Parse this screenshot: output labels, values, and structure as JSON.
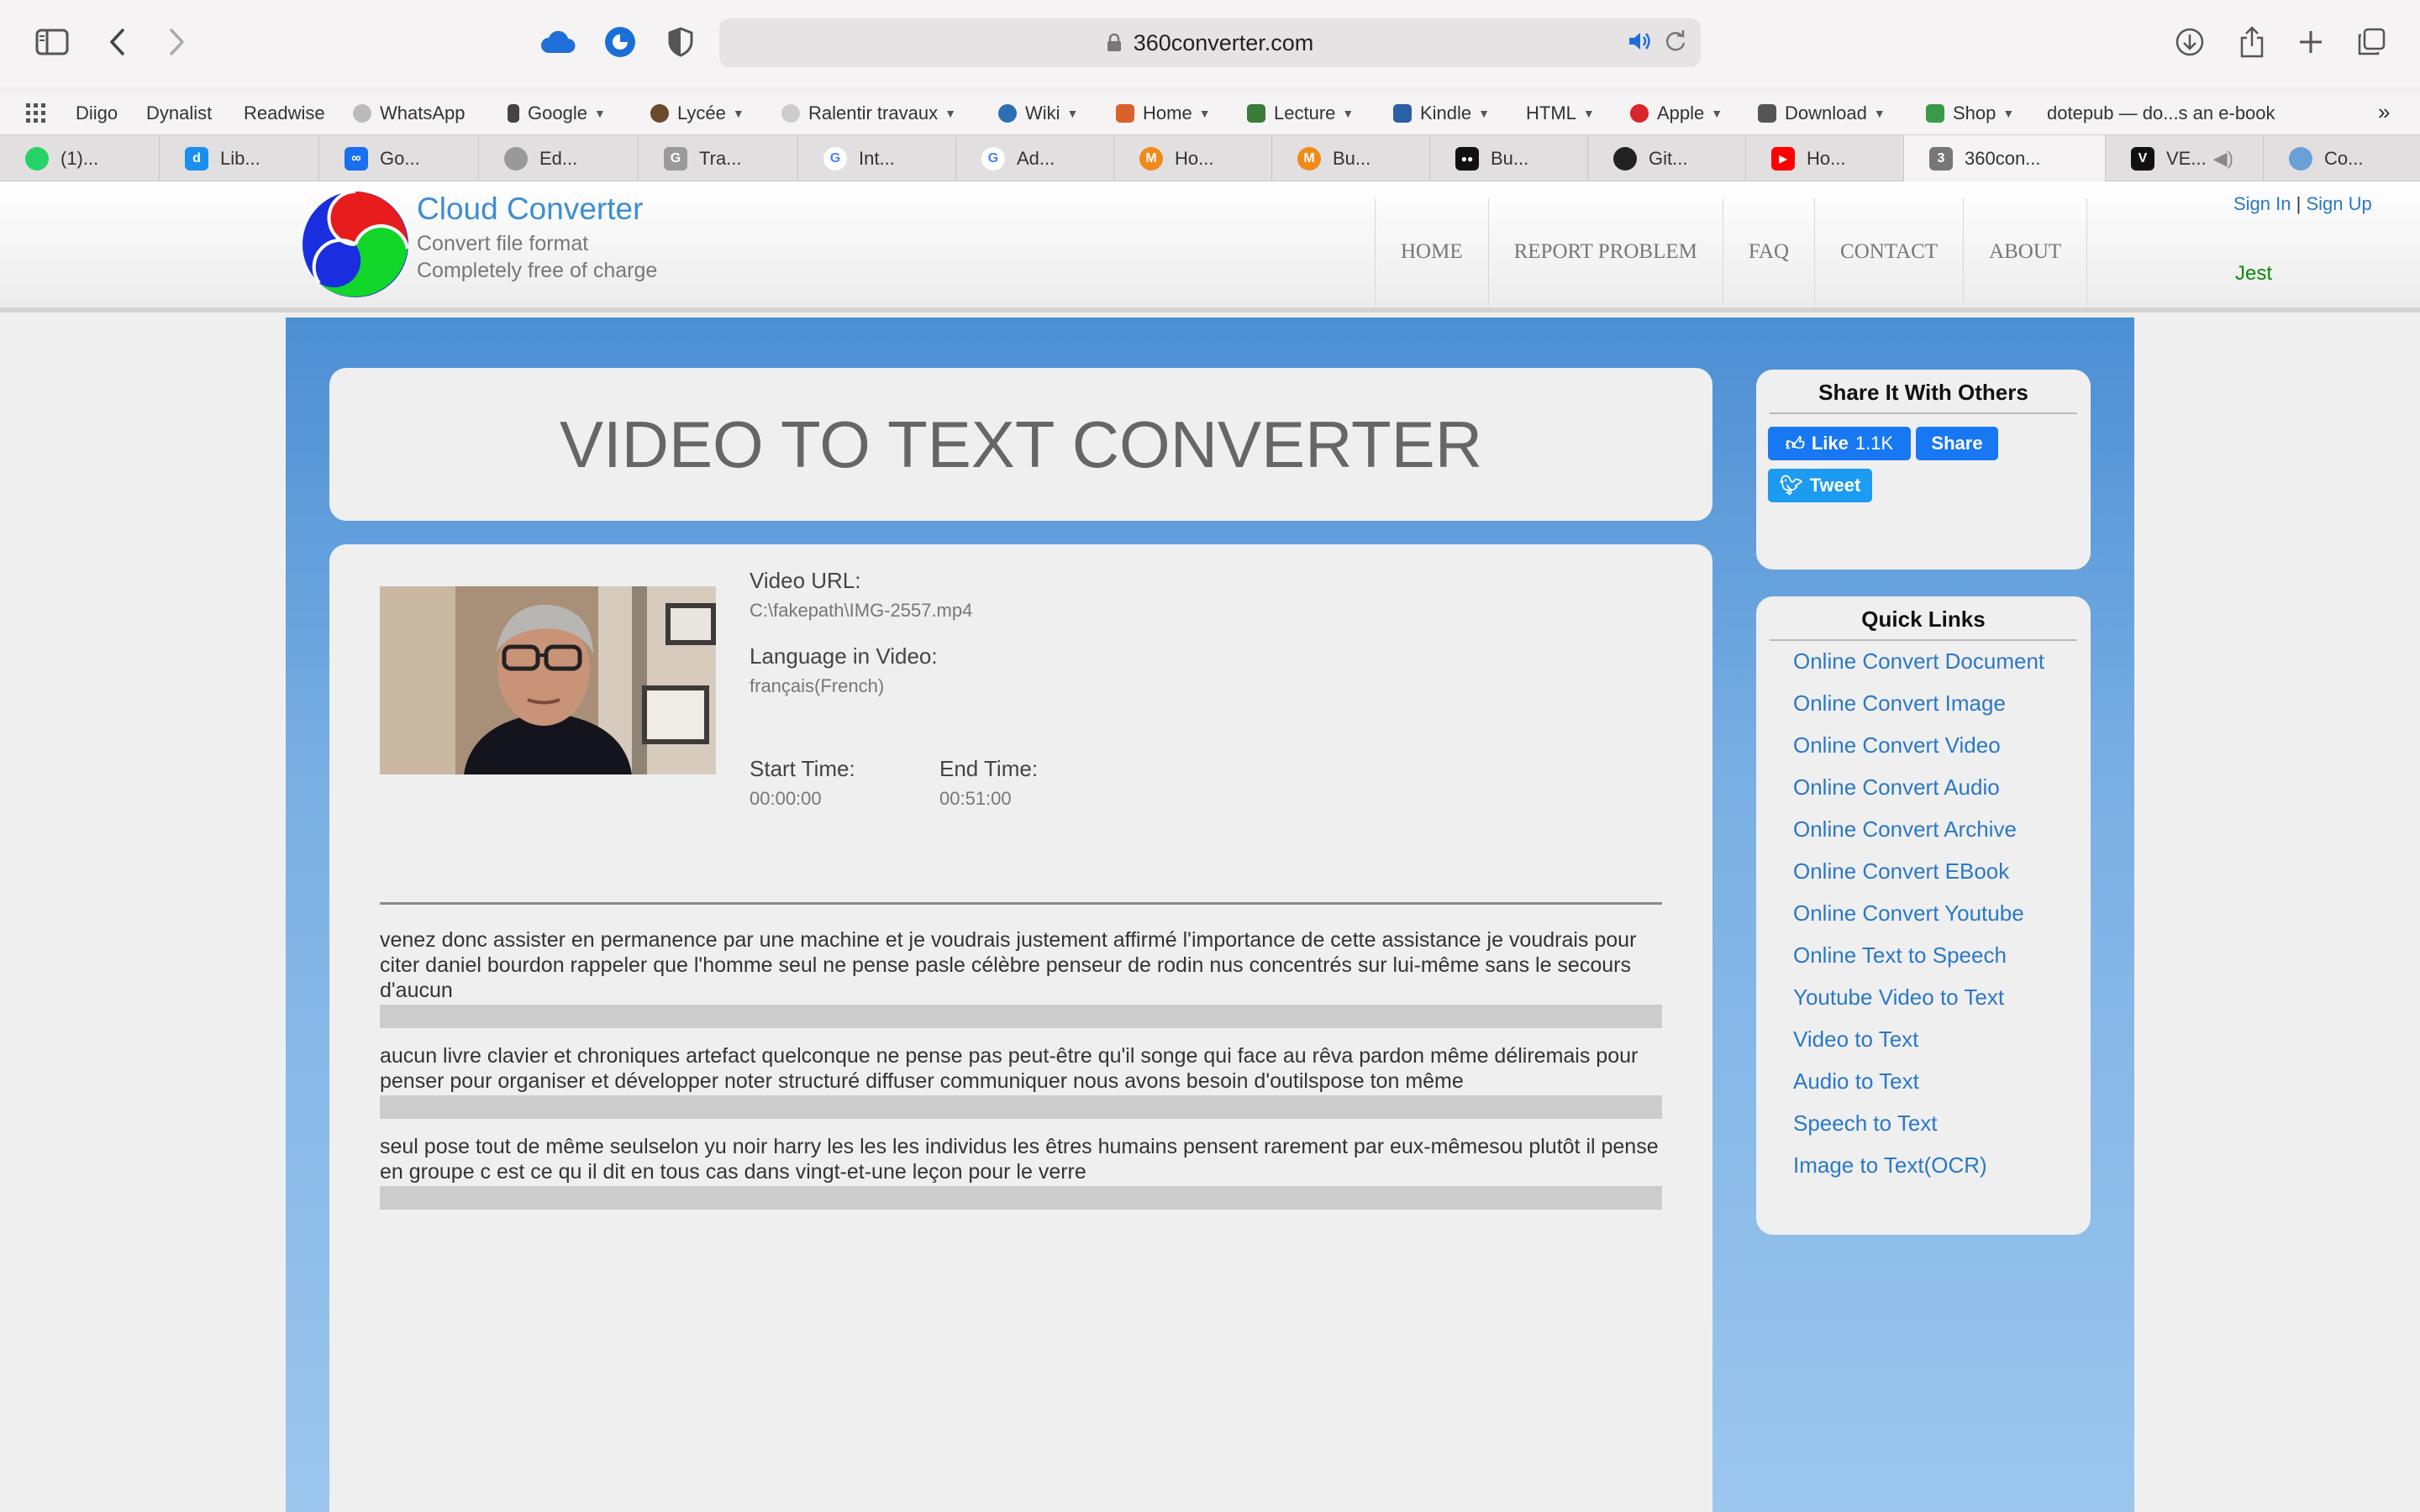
{
  "browser": {
    "url": "360converter.com"
  },
  "bookmarks": [
    {
      "label": "Diigo",
      "color": "",
      "menu": false
    },
    {
      "label": "Dynalist",
      "color": "",
      "menu": false
    },
    {
      "label": "Readwise",
      "color": "",
      "menu": false
    },
    {
      "label": "WhatsApp",
      "color": "#999999",
      "menu": false
    },
    {
      "label": "Google",
      "color": "#444444",
      "menu": true
    },
    {
      "label": "Lycée",
      "color": "#6b4a2e",
      "menu": true
    },
    {
      "label": "Ralentir travaux",
      "color": "#bbbbbb",
      "menu": true
    },
    {
      "label": "Wiki",
      "color": "#2d6fb3",
      "menu": true
    },
    {
      "label": "Home",
      "color": "#d9622b",
      "menu": true
    },
    {
      "label": "Lecture",
      "color": "#3a7d3a",
      "menu": true
    },
    {
      "label": "Kindle",
      "color": "#2b5fa6",
      "menu": true
    },
    {
      "label": "HTML",
      "color": "",
      "menu": true
    },
    {
      "label": "Apple",
      "color": "#d8262b",
      "menu": true
    },
    {
      "label": "Download",
      "color": "#555555",
      "menu": true
    },
    {
      "label": "Shop",
      "color": "#3a9a4a",
      "menu": true
    },
    {
      "label": "dotepub — do...s an e-book",
      "color": "",
      "menu": false
    }
  ],
  "tabs": [
    {
      "label": "(1)...",
      "color": "#25d366",
      "glyph": ""
    },
    {
      "label": "Lib...",
      "color": "#1a8ff0",
      "glyph": "d"
    },
    {
      "label": "Go...",
      "color": "#1a6ef0",
      "glyph": "∞"
    },
    {
      "label": "Ed...",
      "color": "#888888",
      "glyph": ""
    },
    {
      "label": "Tra...",
      "color": "#9a9a9a",
      "glyph": "G"
    },
    {
      "label": "Int...",
      "color": "#4285f4",
      "glyph": "G"
    },
    {
      "label": "Ad...",
      "color": "#4285f4",
      "glyph": "G"
    },
    {
      "label": "Ho...",
      "color": "#f08a1a",
      "glyph": "M"
    },
    {
      "label": "Bu...",
      "color": "#f08a1a",
      "glyph": "M"
    },
    {
      "label": "Bu...",
      "color": "#111111",
      "glyph": "●●"
    },
    {
      "label": "Git...",
      "color": "#222222",
      "glyph": ""
    },
    {
      "label": "Ho...",
      "color": "#ff0000",
      "glyph": "▶"
    },
    {
      "label": "360con...",
      "color": "#777777",
      "glyph": "3"
    },
    {
      "label": "VE...",
      "color": "#111111",
      "glyph": "V"
    },
    {
      "label": "Co...",
      "color": "#6a9fd8",
      "glyph": ""
    }
  ],
  "site": {
    "brand": "Cloud Converter",
    "tagline1": "Convert file format",
    "tagline2": "Completely free of charge",
    "nav": [
      "HOME",
      "REPORT PROBLEM",
      "FAQ",
      "CONTACT",
      "ABOUT"
    ],
    "sign_in": "Sign In",
    "separator": "|",
    "sign_up": "Sign Up",
    "guest_label": "Jest"
  },
  "page": {
    "title": "VIDEO TO TEXT CONVERTER",
    "video_url_label": "Video URL:",
    "video_url": "C:\\fakepath\\IMG-2557.mp4",
    "language_label": "Language in Video:",
    "language": "français(French)",
    "start_label": "Start Time:",
    "start_time": "00:00:00",
    "end_label": "End Time:",
    "end_time": "00:51:00",
    "paragraphs": [
      "venez donc assister en permanence par une machine et je voudrais justement affirmé l'importance de cette assistance je voudrais pour citer daniel bourdon rappeler que l'homme seul ne pense pasle célèbre penseur de rodin nus concentrés sur lui-même sans le secours d'aucun",
      "aucun livre clavier et chroniques artefact quelconque ne pense pas peut-être qu'il songe qui face au rêva pardon même déliremais pour penser pour organiser et développer noter structuré diffuser communiquer nous avons besoin d'outilspose ton même",
      "seul pose tout de même seulselon yu noir harry les les les individus les êtres humains pensent rarement par eux-mêmesou plutôt il pense en groupe c est ce qu il dit en tous cas dans vingt-et-une leçon pour le verre"
    ]
  },
  "share": {
    "title": "Share It With Others",
    "like_label": "Like",
    "like_count": "1.1K",
    "share_label": "Share",
    "tweet_label": "Tweet"
  },
  "quick_links": {
    "title": "Quick Links",
    "items": [
      "Online Convert Document",
      "Online Convert Image",
      "Online Convert Video",
      "Online Convert Audio",
      "Online Convert Archive",
      "Online Convert EBook",
      "Online Convert Youtube",
      "Online Text to Speech",
      "Youtube Video to Text",
      "Video to Text",
      "Audio to Text",
      "Speech to Text",
      "Image to Text(OCR)"
    ]
  },
  "colors": {
    "brand_blue": "#3d8ed2",
    "link_blue": "#2a78c7",
    "guest_green": "#0a8a0a",
    "page_bg_blue": "#4c8fd4"
  }
}
